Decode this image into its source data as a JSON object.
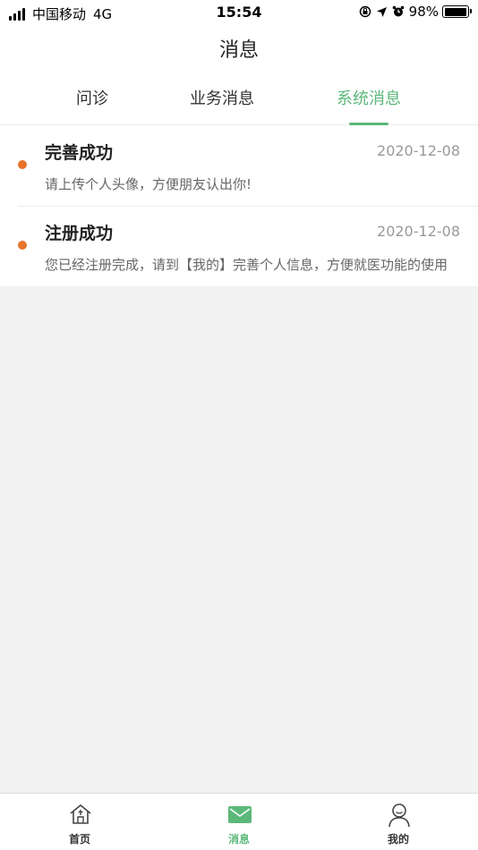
{
  "status_bar": {
    "carrier": "中国移动",
    "network": "4G",
    "time": "15:54",
    "battery": "98%"
  },
  "nav": {
    "title": "消息"
  },
  "tabs": [
    {
      "label": "问诊",
      "active": false
    },
    {
      "label": "业务消息",
      "active": false
    },
    {
      "label": "系统消息",
      "active": true
    }
  ],
  "messages": [
    {
      "title": "完善成功",
      "date": "2020-12-08",
      "body": "请上传个人头像，方便朋友认出你!"
    },
    {
      "title": "注册成功",
      "date": "2020-12-08",
      "body": "您已经注册完成，请到【我的】完善个人信息，方便就医功能的使用"
    }
  ],
  "tabbar": [
    {
      "label": "首页",
      "icon": "home-icon",
      "active": false
    },
    {
      "label": "消息",
      "icon": "mail-icon",
      "active": true
    },
    {
      "label": "我的",
      "icon": "user-icon",
      "active": false
    }
  ],
  "colors": {
    "accent": "#5cb87a",
    "unread_dot": "#e8732b"
  }
}
